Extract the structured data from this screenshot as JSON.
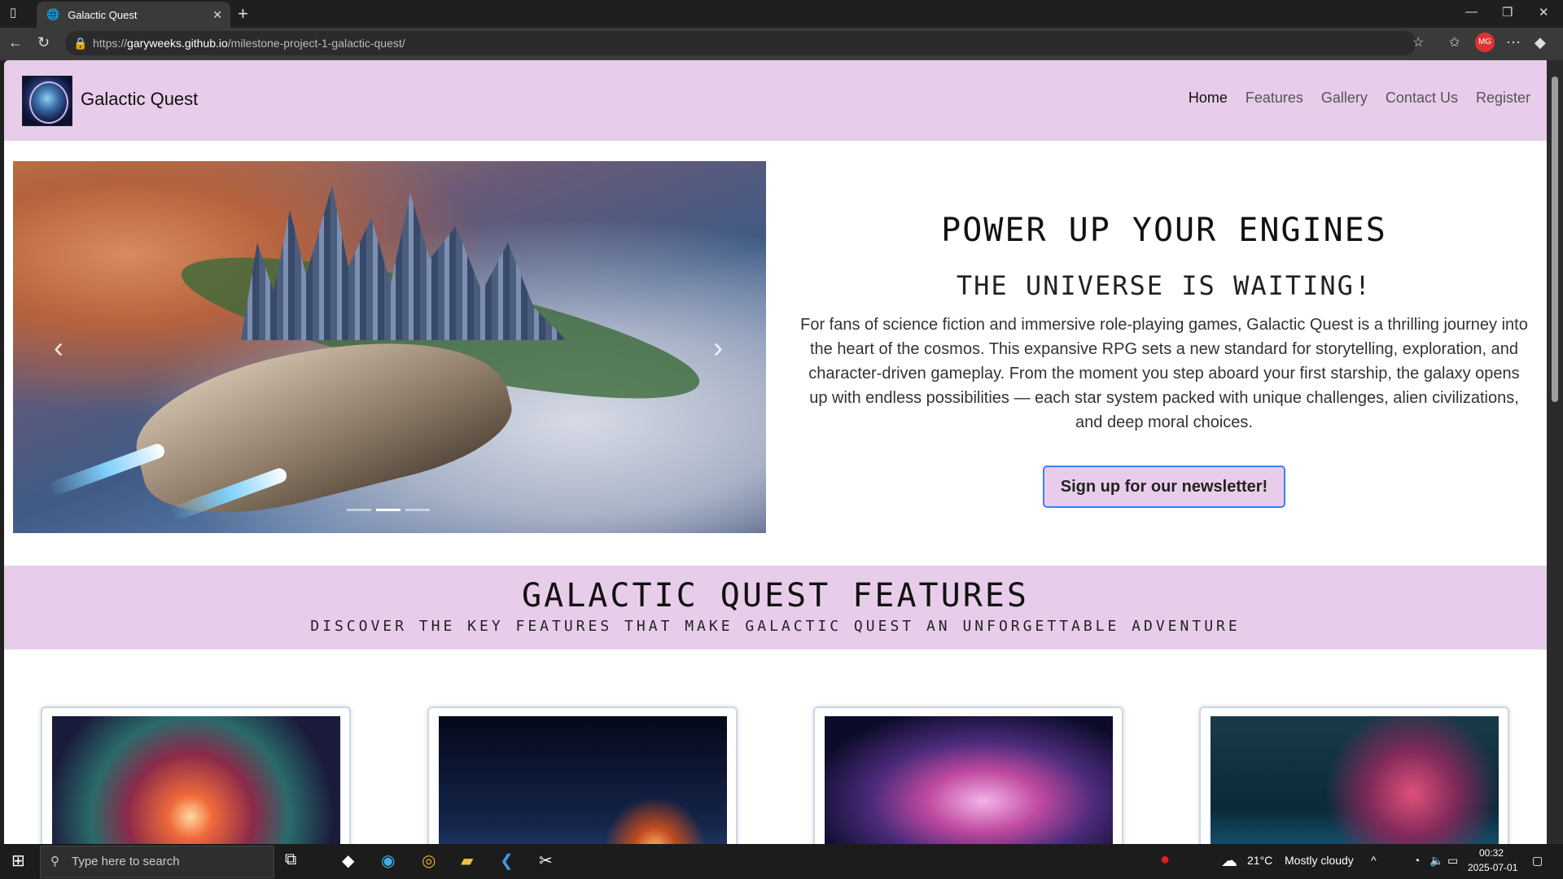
{
  "browser": {
    "tab_title": "Galactic Quest",
    "url_prefix": "https://",
    "url_domain": "garyweeks.github.io",
    "url_path": "/milestone-project-1-galactic-quest/"
  },
  "navbar": {
    "brand": "Galactic Quest",
    "links": [
      {
        "label": "Home",
        "active": true
      },
      {
        "label": "Features"
      },
      {
        "label": "Gallery"
      },
      {
        "label": "Contact Us"
      },
      {
        "label": "Register"
      }
    ]
  },
  "hero": {
    "title": "POWER UP YOUR ENGINES",
    "subtitle": "THE UNIVERSE IS WAITING!",
    "paragraph": "For fans of science fiction and immersive role-playing games, Galactic Quest is a thrilling journey into the heart of the cosmos. This expansive RPG sets a new standard for storytelling, exploration, and character-driven gameplay. From the moment you step aboard your first starship, the galaxy opens up with endless possibilities — each star system packed with unique challenges, alien civilizations, and deep moral choices.",
    "cta": "Sign up for our newsletter!",
    "carousel": {
      "slides": 3,
      "active_slide": 2
    }
  },
  "features": {
    "title": "GALACTIC QUEST FEATURES",
    "subtitle": "DISCOVER THE KEY FEATURES THAT MAKE GALACTIC QUEST AN UNFORGETTABLE ADVENTURE"
  },
  "taskbar": {
    "search_placeholder": "Type here to search",
    "weather": "21°C",
    "weather_desc": "Mostly cloudy",
    "time": "00:32",
    "date": "2025-07-01"
  },
  "colors": {
    "accent": "#e8cdea",
    "button_border": "#3d7ff0"
  }
}
